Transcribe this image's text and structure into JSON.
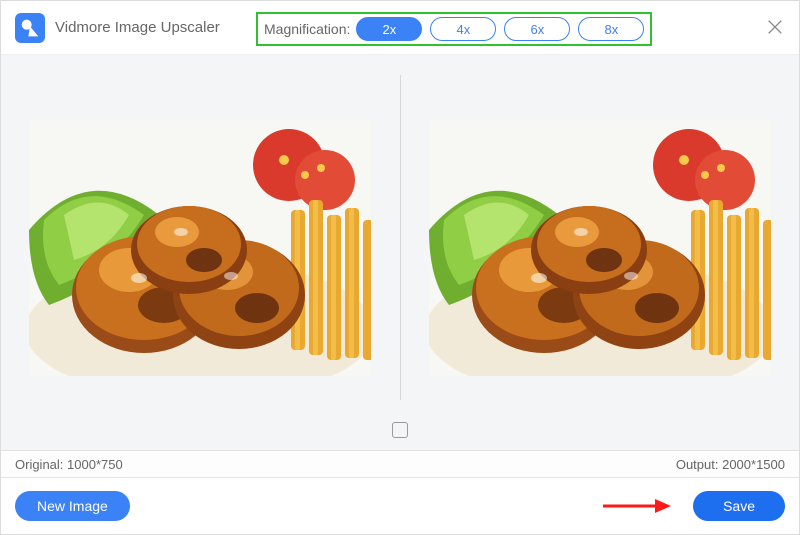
{
  "app_title": "Vidmore Image Upscaler",
  "magnification": {
    "label": "Magnification:",
    "options": [
      "2x",
      "4x",
      "6x",
      "8x"
    ],
    "selected": "2x"
  },
  "info": {
    "original_label": "Original: 1000*750",
    "output_label": "Output: 2000*1500"
  },
  "footer": {
    "new_image_label": "New Image",
    "save_label": "Save"
  }
}
